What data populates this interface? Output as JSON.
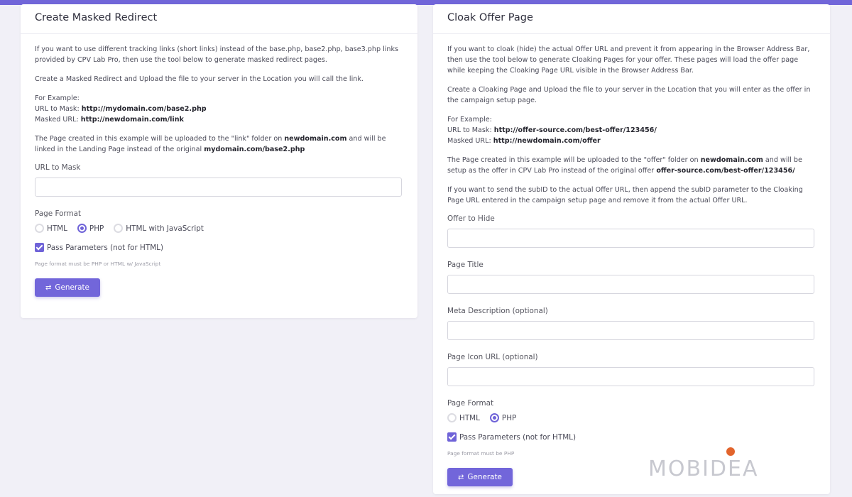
{
  "left": {
    "title": "Create Masked Redirect",
    "p1": "If you want to use different tracking links (short links) instead of the base.php, base2.php, base3.php links provided by CPV Lab Pro, then use the tool below to generate masked redirect pages.",
    "p2": "Create a Masked Redirect and Upload the file to your server in the Location you will call the link.",
    "example_heading": "For Example:",
    "mask_label": "URL to Mask: ",
    "mask_value": "http://mydomain.com/base2.php",
    "masked_label": "Masked URL: ",
    "masked_value": "http://newdomain.com/link",
    "p4_a": "The Page created in this example will be uploaded to the \"link\" folder on ",
    "p4_b": "newdomain.com",
    "p4_c": " and will be linked in the Landing Page instead of the original ",
    "p4_d": "mydomain.com/base2.php",
    "field_url": "URL to Mask",
    "page_format": "Page Format",
    "radio_html": "HTML",
    "radio_php": "PHP",
    "radio_js": "HTML with JavaScript",
    "pass_params": "Pass Parameters (not for HTML)",
    "hint": "Page format must be PHP or HTML w/ JavaScript",
    "generate": "Generate"
  },
  "right": {
    "title": "Cloak Offer Page",
    "p1": "If you want to cloak (hide) the actual Offer URL and prevent it from appearing in the Browser Address Bar, then use the tool below to generate Cloaking Pages for your offer. These pages will load the offer page while keeping the Cloaking Page URL visible in the Browser Address Bar.",
    "p2": "Create a Cloaking Page and Upload the file to your server in the Location that you will enter as the offer in the campaign setup page.",
    "example_heading": "For Example:",
    "mask_label": "URL to Mask: ",
    "mask_value": "http://offer-source.com/best-offer/123456/",
    "masked_label": "Masked URL: ",
    "masked_value": "http://newdomain.com/offer",
    "p4_a": "The Page created in this example will be uploaded to the \"offer\" folder on ",
    "p4_b": "newdomain.com",
    "p4_c": " and will be setup as the offer in CPV Lab Pro instead of the original offer ",
    "p4_d": "offer-source.com/best-offer/123456/",
    "p5": "If you want to send the subID to the actual Offer URL, then append the subID parameter to the Cloaking Page URL entered in the campaign setup page and remove it from the actual Offer URL.",
    "field_offer": "Offer to Hide",
    "field_title": "Page Title",
    "field_meta": "Meta Description (optional)",
    "field_icon": "Page Icon URL (optional)",
    "page_format": "Page Format",
    "radio_html": "HTML",
    "radio_php": "PHP",
    "pass_params": "Pass Parameters (not for HTML)",
    "hint": "Page format must be PHP",
    "generate": "Generate"
  },
  "watermark": "MOBIDEA",
  "colors": {
    "accent": "#7266da",
    "topbar": "#7166d9",
    "watermark_dot": "#e2642c"
  },
  "icons": {
    "generate": "refresh-icon"
  }
}
